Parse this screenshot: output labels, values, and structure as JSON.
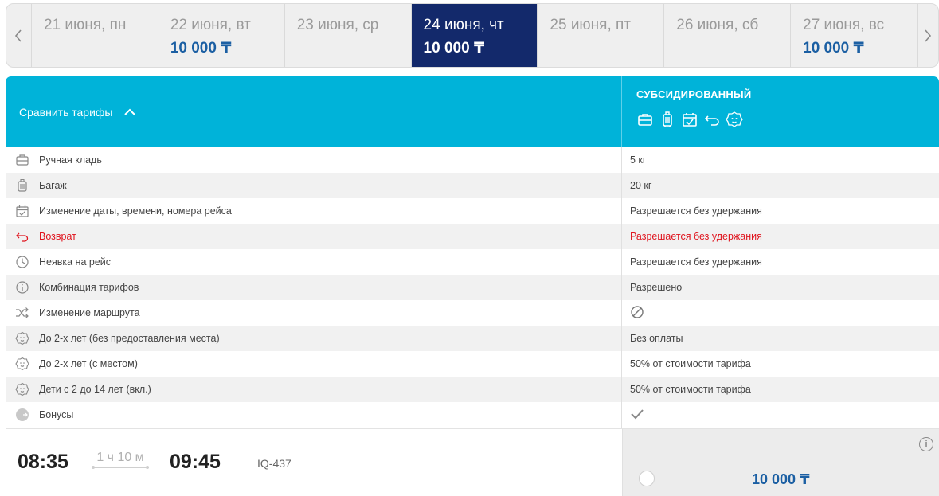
{
  "dates": [
    {
      "label": "21 июня, пн",
      "price": ""
    },
    {
      "label": "22 июня, вт",
      "price": "10 000 ₸"
    },
    {
      "label": "23 июня, ср",
      "price": ""
    },
    {
      "label": "24 июня, чт",
      "price": "10 000 ₸",
      "active": true
    },
    {
      "label": "25 июня, пт",
      "price": ""
    },
    {
      "label": "26 июня, сб",
      "price": ""
    },
    {
      "label": "27 июня, вс",
      "price": "10 000 ₸"
    }
  ],
  "compare_label": "Сравнить тарифы",
  "fare": {
    "name": "СУБСИДИРОВАННЫЙ",
    "icons": [
      "briefcase-icon",
      "luggage-icon",
      "calendar-check-icon",
      "return-arrow-icon",
      "baby-face-icon"
    ]
  },
  "rows": [
    {
      "icon": "briefcase-icon",
      "label": "Ручная кладь",
      "value": "5 кг"
    },
    {
      "icon": "luggage-icon",
      "label": "Багаж",
      "value": "20 кг"
    },
    {
      "icon": "calendar-check-icon",
      "label": "Изменение даты, времени, номера рейса",
      "value": "Разрешается без удержания"
    },
    {
      "icon": "return-arrow-icon",
      "label": "Возврат",
      "value": "Разрешается без удержания",
      "highlight": "#e0141e"
    },
    {
      "icon": "clock-icon",
      "label": "Неявка на рейс",
      "value": "Разрешается без удержания"
    },
    {
      "icon": "info-circle-icon",
      "label": "Комбинация тарифов",
      "value": "Разрешено"
    },
    {
      "icon": "shuffle-icon",
      "label": "Изменение маршрута",
      "value": "",
      "value_icon": "not-allowed-icon"
    },
    {
      "icon": "baby-face-icon",
      "label": "До 2-х лет (без предоставления места)",
      "value": "Без оплаты"
    },
    {
      "icon": "baby-face-icon",
      "label": "До 2-х лет (с местом)",
      "value": "50% от стоимости тарифа"
    },
    {
      "icon": "baby-face-icon",
      "label": "Дети с 2 до 14 лет (вкл.)",
      "value": "50% от стоимости тарифа"
    },
    {
      "icon": "bonus-icon",
      "label": "Бонусы",
      "value": "",
      "value_icon": "checkmark-icon"
    }
  ],
  "flight": {
    "departure": "08:35",
    "duration": "1 ч 10 м",
    "arrival": "09:45",
    "number": "IQ-437",
    "price": "10 000 ₸"
  },
  "colors": {
    "header_bg": "#00b3d9",
    "active_date_bg": "#13296b",
    "price_blue": "#1b5fa3",
    "refund_red": "#e0141e"
  }
}
